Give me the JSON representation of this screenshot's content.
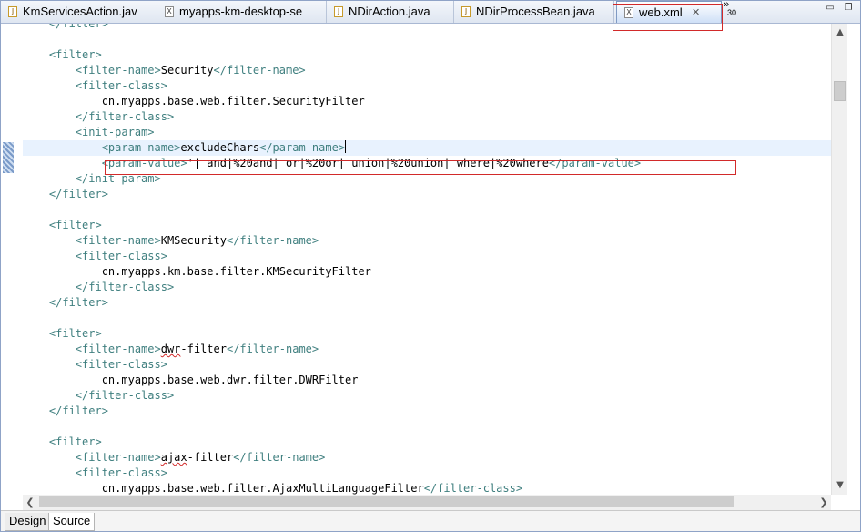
{
  "tabs": [
    {
      "label": "KmServicesAction.jav",
      "icon": "java-file-icon",
      "active": false
    },
    {
      "label": "myapps-km-desktop-se",
      "icon": "xml-file-icon",
      "active": false
    },
    {
      "label": "NDirAction.java",
      "icon": "java-file-icon",
      "active": false
    },
    {
      "label": "NDirProcessBean.java",
      "icon": "java-file-icon",
      "active": false
    },
    {
      "label": "web.xml",
      "icon": "xml-file-icon",
      "active": true
    }
  ],
  "tab_close_glyph": "✕",
  "hidden_tab_count": "30",
  "overflow_chevron": "»",
  "window_controls": {
    "minimize": "▭",
    "restore": "❐"
  },
  "code_lines": [
    [
      {
        "t": "tag",
        "v": "    </filter>"
      }
    ],
    [
      {
        "t": "txt",
        "v": ""
      }
    ],
    [
      {
        "t": "tag",
        "v": "    <filter>"
      }
    ],
    [
      {
        "t": "tag",
        "v": "        <filter-name>"
      },
      {
        "t": "txt",
        "v": "Security"
      },
      {
        "t": "tag",
        "v": "</filter-name>"
      }
    ],
    [
      {
        "t": "tag",
        "v": "        <filter-class>"
      }
    ],
    [
      {
        "t": "txt",
        "v": "            cn.myapps.base.web.filter.SecurityFilter"
      }
    ],
    [
      {
        "t": "tag",
        "v": "        </filter-class>"
      }
    ],
    [
      {
        "t": "tag",
        "v": "        <init-param>"
      }
    ],
    [
      {
        "t": "tag",
        "v": "            <param-name>"
      },
      {
        "t": "txt",
        "v": "excludeChars"
      },
      {
        "t": "tag",
        "v": "</param-name>"
      },
      {
        "t": "caret",
        "v": ""
      }
    ],
    [
      {
        "t": "tag",
        "v": "            <param-value>"
      },
      {
        "t": "txt",
        "v": "'| and|%20and| or|%20or| union|%20union| where|%20where"
      },
      {
        "t": "tag",
        "v": "</param-value>"
      }
    ],
    [
      {
        "t": "tag",
        "v": "        </init-param>"
      }
    ],
    [
      {
        "t": "tag",
        "v": "    </filter>"
      }
    ],
    [
      {
        "t": "txt",
        "v": ""
      }
    ],
    [
      {
        "t": "tag",
        "v": "    <filter>"
      }
    ],
    [
      {
        "t": "tag",
        "v": "        <filter-name>"
      },
      {
        "t": "txt",
        "v": "KMSecurity"
      },
      {
        "t": "tag",
        "v": "</filter-name>"
      }
    ],
    [
      {
        "t": "tag",
        "v": "        <filter-class>"
      }
    ],
    [
      {
        "t": "txt",
        "v": "            cn.myapps.km.base.filter.KMSecurityFilter"
      }
    ],
    [
      {
        "t": "tag",
        "v": "        </filter-class>"
      }
    ],
    [
      {
        "t": "tag",
        "v": "    </filter>"
      }
    ],
    [
      {
        "t": "txt",
        "v": ""
      }
    ],
    [
      {
        "t": "tag",
        "v": "    <filter>"
      }
    ],
    [
      {
        "t": "tag",
        "v": "        <filter-name>"
      },
      {
        "t": "squig",
        "v": "dwr"
      },
      {
        "t": "txt",
        "v": "-filter"
      },
      {
        "t": "tag",
        "v": "</filter-name>"
      }
    ],
    [
      {
        "t": "tag",
        "v": "        <filter-class>"
      }
    ],
    [
      {
        "t": "txt",
        "v": "            cn.myapps.base.web.dwr.filter.DWRFilter"
      }
    ],
    [
      {
        "t": "tag",
        "v": "        </filter-class>"
      }
    ],
    [
      {
        "t": "tag",
        "v": "    </filter>"
      }
    ],
    [
      {
        "t": "txt",
        "v": ""
      }
    ],
    [
      {
        "t": "tag",
        "v": "    <filter>"
      }
    ],
    [
      {
        "t": "tag",
        "v": "        <filter-name>"
      },
      {
        "t": "squig",
        "v": "ajax"
      },
      {
        "t": "txt",
        "v": "-filter"
      },
      {
        "t": "tag",
        "v": "</filter-name>"
      }
    ],
    [
      {
        "t": "tag",
        "v": "        <filter-class>"
      }
    ],
    [
      {
        "t": "txt",
        "v": "            cn.myapps.base.web.filter.AjaxMultiLanguageFilter"
      },
      {
        "t": "tag",
        "v": "</filter-class>"
      }
    ]
  ],
  "current_line": 8,
  "scroll_arrows": {
    "up": "▲",
    "down": "▼",
    "left": "❮",
    "right": "❯"
  },
  "bottom_tabs": [
    {
      "label": "Design",
      "active": false
    },
    {
      "label": "Source",
      "active": true
    }
  ]
}
